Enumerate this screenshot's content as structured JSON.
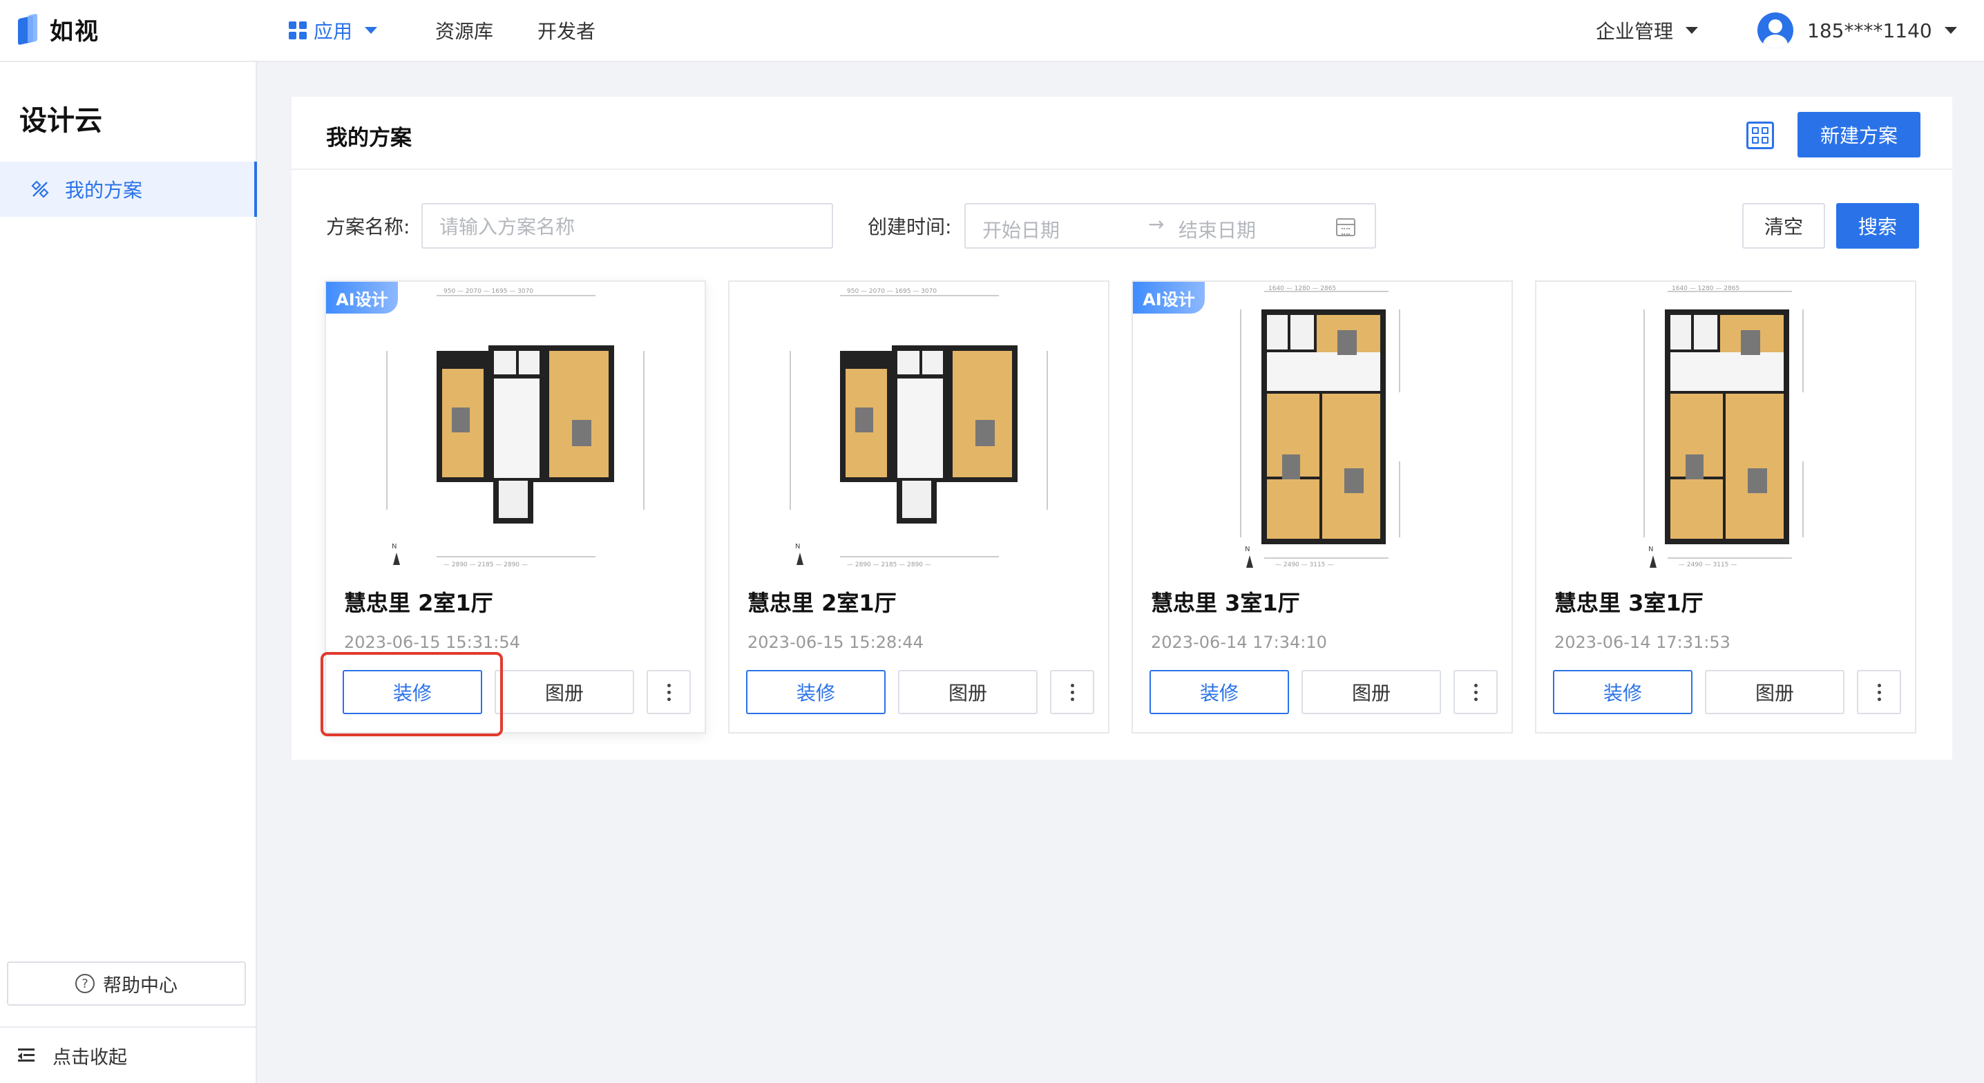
{
  "topbar": {
    "logo": "如视",
    "nav": [
      "应用",
      "资源库",
      "开发者"
    ],
    "enterprise": "企业管理",
    "user": "185****1140"
  },
  "sidebar": {
    "title": "设计云",
    "active_item": "我的方案",
    "help": "帮助中心",
    "collapse": "点击收起"
  },
  "panel": {
    "title": "我的方案",
    "new_button": "新建方案"
  },
  "filter": {
    "name_label": "方案名称:",
    "name_placeholder": "请输入方案名称",
    "time_label": "创建时间:",
    "start_placeholder": "开始日期",
    "end_placeholder": "结束日期",
    "clear": "清空",
    "search": "搜索"
  },
  "cards": [
    {
      "title": "慧忠里 2室1厅",
      "time": "2023-06-15 15:31:54",
      "badge": "AI设计",
      "decor": "装修",
      "album": "图册"
    },
    {
      "title": "慧忠里 2室1厅",
      "time": "2023-06-15 15:28:44",
      "badge": "",
      "decor": "装修",
      "album": "图册"
    },
    {
      "title": "慧忠里 3室1厅",
      "time": "2023-06-14 17:34:10",
      "badge": "AI设计",
      "decor": "装修",
      "album": "图册"
    },
    {
      "title": "慧忠里 3室1厅",
      "time": "2023-06-14 17:31:53",
      "badge": "",
      "decor": "装修",
      "album": "图册"
    }
  ],
  "colors": {
    "accent": "#2a72e8",
    "highlight": "#e23a2e",
    "badge": "#3f8cff"
  }
}
